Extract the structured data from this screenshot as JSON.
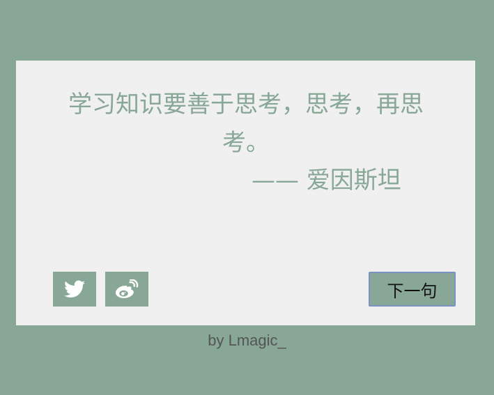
{
  "theme": {
    "accent": "#88a797",
    "card_bg": "#f0f0f0"
  },
  "quote": {
    "text": "学习知识要善于思考，思考，再思考。",
    "author": "—— 爱因斯坦"
  },
  "share": {
    "twitter_icon": "twitter-bird-icon",
    "weibo_icon": "weibo-icon"
  },
  "actions": {
    "next_label": "下一句"
  },
  "footer": {
    "credit": "by Lmagic_"
  }
}
